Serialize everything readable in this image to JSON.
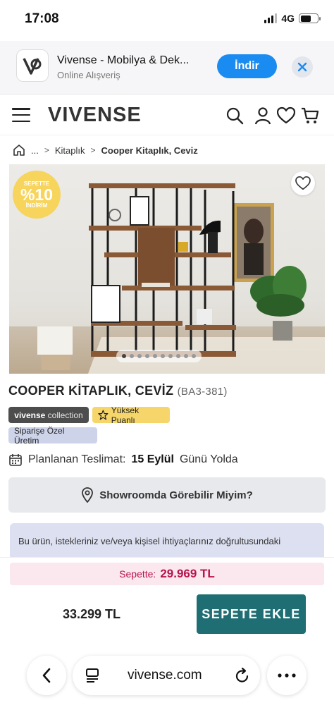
{
  "status_bar": {
    "time": "17:08",
    "network": "4G"
  },
  "app_banner": {
    "name": "Vivense - Mobilya & Dek...",
    "subtitle": "Online Alışveriş",
    "install_label": "İndir"
  },
  "header": {
    "logo": "VIVENSE"
  },
  "breadcrumb": {
    "ellipsis": "...",
    "items": [
      "Kitaplık",
      "Cooper Kitaplık, Ceviz"
    ]
  },
  "product": {
    "promo_badge": {
      "top": "SEPETTE",
      "value": "%10",
      "bottom": "İNDİRİM"
    },
    "gallery": {
      "total_images": 10,
      "active_index": 0
    },
    "title": "COOPER KİTAPLIK, CEVİZ",
    "code": "(BA3-381)",
    "tags": {
      "collection_brand": "vivense",
      "collection_word": "collection",
      "rating": "Yüksek Puanlı",
      "custom": "Siparişe Özel Üretim"
    },
    "delivery": {
      "label": "Planlanan Teslimat:",
      "date": "15 Eylül",
      "suffix": "Günü Yolda"
    },
    "showroom_label": "Showroomda Görebilir Miyim?",
    "info_text": "Bu ürün, istekleriniz ve/veya kişisel ihtiyaçlarınız doğrultusundaki"
  },
  "purchase": {
    "basket_label": "Sepette:",
    "basket_price": "29.969 TL",
    "list_price": "33.299 TL",
    "add_to_cart": "SEPETE EKLE"
  },
  "browser": {
    "url": "vivense.com"
  },
  "colors": {
    "accent_teal": "#1f6e73",
    "install_blue": "#1a8bf0",
    "basket_red": "#b8144d",
    "promo_yellow": "#f7d45b"
  }
}
